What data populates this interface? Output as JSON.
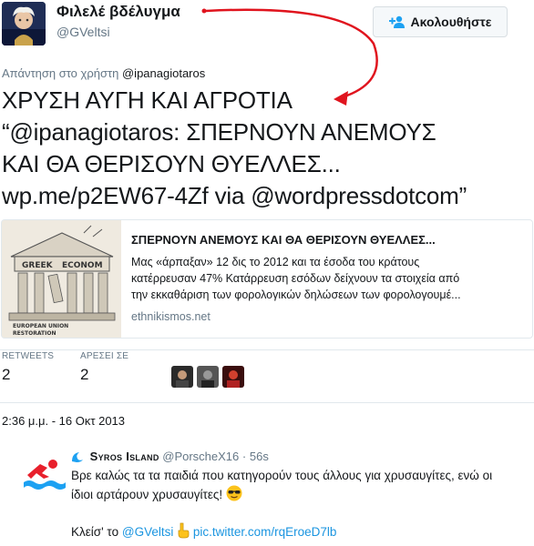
{
  "author": {
    "display_name": "Φιλελέ βδέλυγμα",
    "screen_name": "@GVeltsi"
  },
  "follow_button": {
    "label": "Ακολουθήστε",
    "icon": "add-user-icon"
  },
  "reply_context": {
    "prefix": "Απάντηση στο χρήστη",
    "user": "@ipanagiotaros"
  },
  "tweet": {
    "lines": [
      "ΧΡΥΣΗ ΑΥΓΗ ΚΑΙ ΑΓΡΟΤΙΑ",
      "“@ipanagiotaros: ΣΠΕΡΝΟΥΝ ΑΝΕΜΟΥΣ",
      "ΚΑΙ ΘΑ ΘΕΡΙΣΟΥΝ ΘΥΕΛΛΕΣ...",
      "wp.me/p2EW67-4Zf via @wordpressdotcom”"
    ],
    "annotation_color": "#e0141e"
  },
  "card": {
    "title": "ΣΠΕΡΝΟΥΝ ΑΝΕΜΟΥΣ ΚΑΙ ΘΑ ΘΕΡΙΣΟΥΝ ΘΥΕΛΛΕΣ...",
    "description_lines": [
      "Μας «άρπαξαν» 12 δις το 2012 και τα έσοδα του κράτους",
      "κατέρρευσαν 47% Κατάρρευση εσόδων δείχνουν τα στοιχεία από",
      "την εκκαθάριση των φορολογικών δηλώσεων των φορολογουμέ..."
    ],
    "domain": "ethnikismos.net",
    "thumb_labels": [
      "GREEK",
      "ECONOM",
      "EUROPEAN UNION",
      "RESTORATION"
    ]
  },
  "stats": {
    "retweets_label": "RETWEETS",
    "retweets_value": "2",
    "likes_label": "ΑΡΕΣΕΙ ΣΕ",
    "likes_value": "2"
  },
  "timestamp": "2:36 μ.μ. - 16 Οκτ 2013",
  "reply": {
    "name": "Syros Island",
    "handle": "@PorscheX16",
    "time": "56s",
    "separator": "·",
    "body_line1": "Βρε καλώς τα τα παιδιά που κατηγορούν τους άλλους για χρυσαυγίτες, ενώ οι",
    "body_line2": "ίδιοι αρτάρουν χρυσαυγίτες!",
    "footer_prefix": "Κλείσ' το",
    "footer_mention": "@GVeltsi",
    "footer_link": "pic.twitter.com/rqEroeD7lb"
  },
  "colors": {
    "link": "#1b95e0",
    "muted": "#657786",
    "text": "#14171a",
    "swimmer_icon": "#e8202c",
    "water_icon": "#1da1f2"
  }
}
